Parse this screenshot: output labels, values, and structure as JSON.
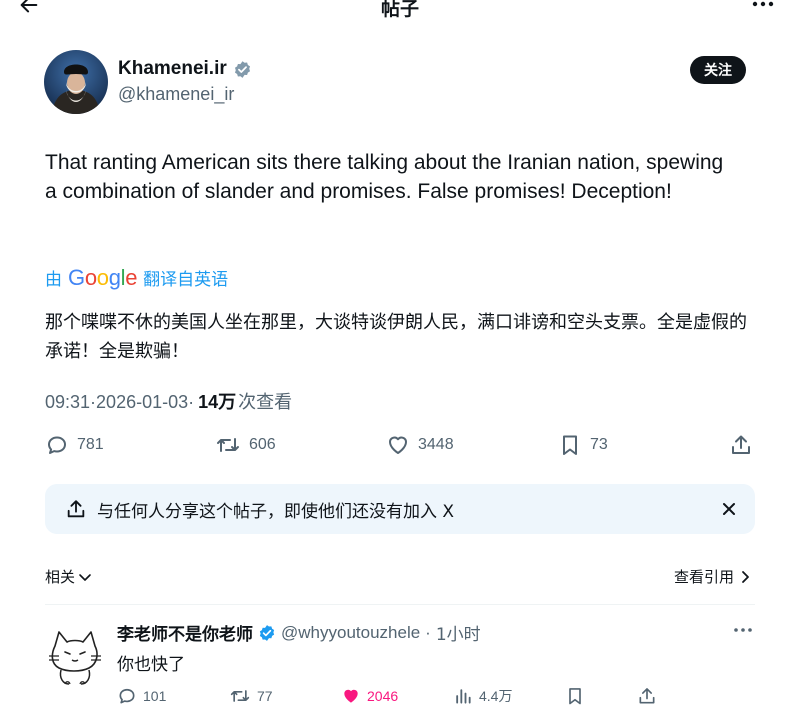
{
  "header": {
    "title": "帖子"
  },
  "author": {
    "name": "Khamenei.ir",
    "handle": "@khamenei_ir",
    "follow_label": "关注"
  },
  "post": {
    "text": "That ranting American sits there talking about the Iranian nation, spewing a combination of slander and promises. False promises! Deception!",
    "translate": {
      "prefix": "由",
      "brand": "Google",
      "suffix": "翻译自英语"
    },
    "translation": "那个喋喋不休的美国人坐在那里，大谈特谈伊朗人民，满口诽谤和空头支票。全是虚假的承诺！全是欺骗！",
    "time": "09:31",
    "separator": "·",
    "date": "2026-01-03",
    "views_count": "14万",
    "views_label": "次查看"
  },
  "actions": {
    "replies": "781",
    "reposts": "606",
    "likes": "3448",
    "bookmarks": "73"
  },
  "share_banner": {
    "text": "与任何人分享这个帖子，即使他们还没有加入 X"
  },
  "related_label": "相关",
  "quotes_label": "查看引用",
  "reply": {
    "name": "李老师不是你老师",
    "handle": "@whyyoutouzhele",
    "dot": "·",
    "time": "1小时",
    "text": "你也快了",
    "replies": "101",
    "reposts": "77",
    "likes": "2046",
    "views": "4.4万"
  },
  "colors": {
    "accent": "#1d9bf0",
    "verified": "#829aab",
    "like": "#f91880",
    "muted": "#536471",
    "banner_bg": "#eef6fc"
  },
  "icons": [
    "back-arrow-icon",
    "more-icon",
    "verified-icon",
    "reply-icon",
    "repost-icon",
    "like-icon",
    "bookmark-icon",
    "share-icon",
    "close-icon",
    "chevron-down-icon",
    "chevron-right-icon",
    "views-icon"
  ]
}
